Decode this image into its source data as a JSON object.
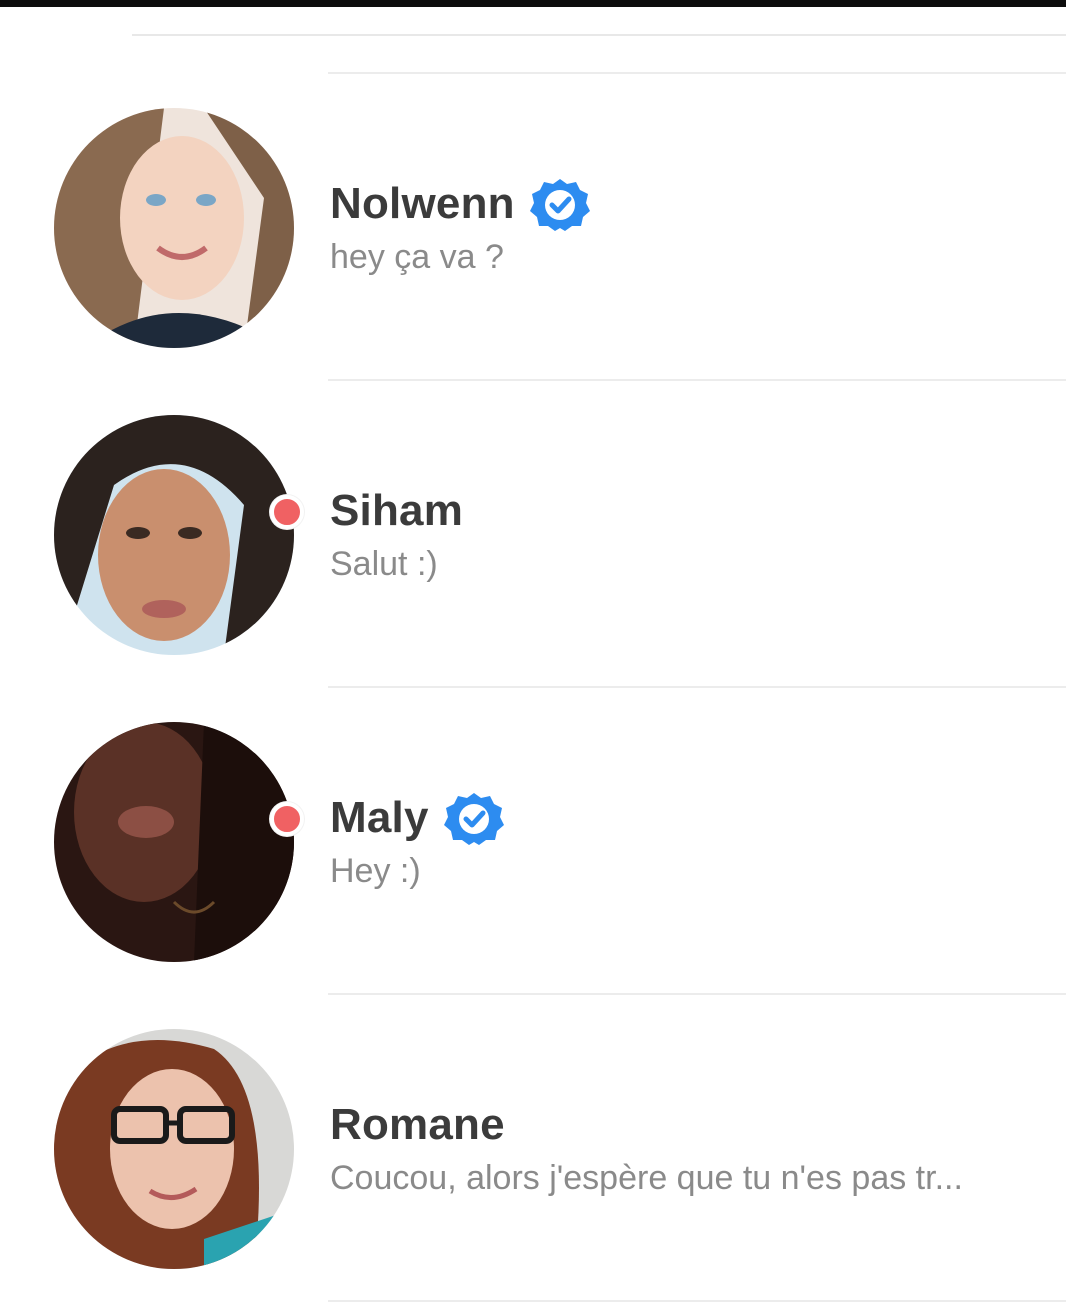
{
  "colors": {
    "name": "#3b3b3b",
    "message": "#8a8a8a",
    "unread_dot": "#f06163",
    "verified_badge": "#2d8cf0",
    "divider": "#ececec"
  },
  "matches": [
    {
      "name": "Nolwenn",
      "message": "hey ça va ?",
      "verified": true,
      "unread": false,
      "avatar_icon": "profile-photo"
    },
    {
      "name": "Siham",
      "message": "Salut :)",
      "verified": false,
      "unread": true,
      "avatar_icon": "profile-photo"
    },
    {
      "name": "Maly",
      "message": "Hey :)",
      "verified": true,
      "unread": true,
      "avatar_icon": "profile-photo"
    },
    {
      "name": "Romane",
      "message": "Coucou, alors j'espère que tu n'es pas tr...",
      "verified": false,
      "unread": false,
      "avatar_icon": "profile-photo"
    }
  ]
}
